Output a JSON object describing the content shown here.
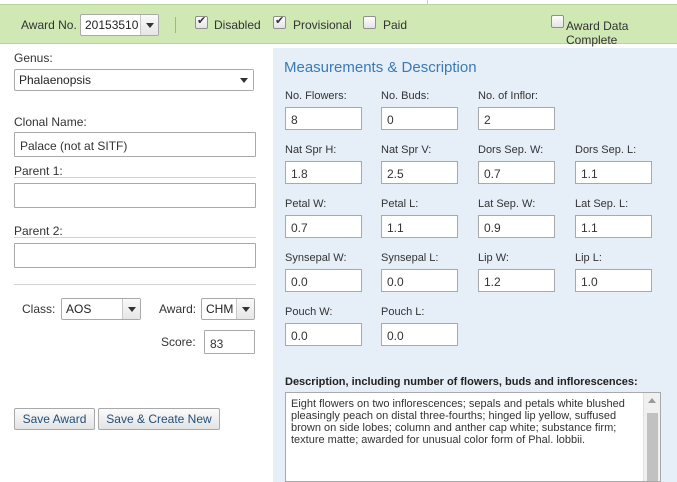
{
  "award_bar": {
    "award_no_label": "Award No.",
    "award_no_value": "20153510",
    "disabled_label": "Disabled",
    "disabled_checked": true,
    "provisional_label": "Provisional",
    "provisional_checked": true,
    "paid_label": "Paid",
    "paid_checked": false,
    "award_data_complete_label": "Award Data Complete",
    "award_data_complete_checked": false
  },
  "left": {
    "genus_label": "Genus:",
    "genus_value": "Phalaenopsis",
    "clonal_name_label": "Clonal Name:",
    "clonal_name_value": "Palace (not at SITF)",
    "parent1_label": "Parent 1:",
    "parent1_value": "",
    "parent2_label": "Parent 2:",
    "parent2_value": "",
    "class_label": "Class:",
    "class_value": "AOS",
    "award_label": "Award:",
    "award_value": "CHM",
    "score_label": "Score:",
    "score_value": "83",
    "save_award_label": "Save Award",
    "save_create_new_label": "Save & Create New"
  },
  "measurements": {
    "title": "Measurements & Description",
    "fields": [
      {
        "label": "No. Flowers:",
        "value": "8"
      },
      {
        "label": "No. Buds:",
        "value": "0"
      },
      {
        "label": "No. of Inflor:",
        "value": "2"
      },
      {
        "label": "Nat Spr H:",
        "value": "1.8"
      },
      {
        "label": "Nat Spr V:",
        "value": "2.5"
      },
      {
        "label": "Dors Sep. W:",
        "value": "0.7"
      },
      {
        "label": "Dors Sep. L:",
        "value": "1.1"
      },
      {
        "label": "Petal W:",
        "value": "0.7"
      },
      {
        "label": "Petal L:",
        "value": "1.1"
      },
      {
        "label": "Lat Sep. W:",
        "value": "0.9"
      },
      {
        "label": "Lat Sep. L:",
        "value": "1.1"
      },
      {
        "label": "Synsepal W:",
        "value": "0.0"
      },
      {
        "label": "Synsepal L:",
        "value": "0.0"
      },
      {
        "label": "Lip W:",
        "value": "1.2"
      },
      {
        "label": "Lip L:",
        "value": "1.0"
      },
      {
        "label": "Pouch W:",
        "value": "0.0"
      },
      {
        "label": "Pouch L:",
        "value": "0.0"
      }
    ],
    "description_label": "Description, including number of flowers, buds and inflorescences:",
    "description_value": "Eight flowers on two inflorescences; sepals and petals white blushed pleasingly peach on distal three-fourths; hinged lip yellow, suffused brown on side lobes; column and anther cap white; substance firm; texture matte; awarded for unusual color form of Phal. lobbii."
  },
  "colors": {
    "award_bar_bg": "#cfe8b4",
    "panel_bg": "#e6eef7",
    "panel_title": "#3b7ab5"
  }
}
